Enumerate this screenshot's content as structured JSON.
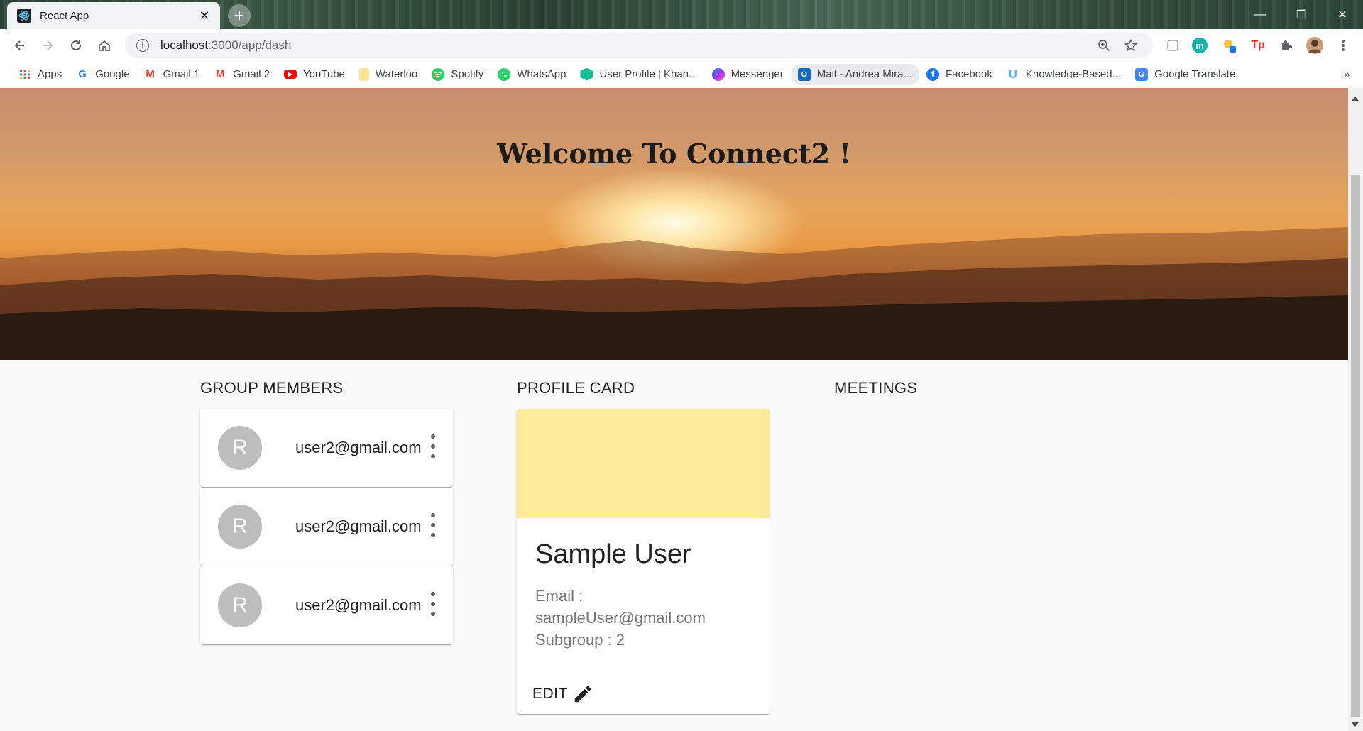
{
  "browser": {
    "tab_title": "React App",
    "tab_close": "✕",
    "new_tab": "+",
    "url_host": "localhost",
    "url_rest": ":3000/app/dash",
    "window_controls": {
      "minimize": "—",
      "restore": "❐",
      "close": "✕"
    },
    "extensions": [
      "m",
      "Tp"
    ],
    "bookmarks_more": "»",
    "bookmarks": [
      {
        "label": "Apps",
        "icon": "apps-grid-icon"
      },
      {
        "label": "Google",
        "icon": "google-icon"
      },
      {
        "label": "Gmail 1",
        "icon": "gmail-icon"
      },
      {
        "label": "Gmail 2",
        "icon": "gmail-icon"
      },
      {
        "label": "YouTube",
        "icon": "youtube-icon"
      },
      {
        "label": "Waterloo",
        "icon": "folder-icon"
      },
      {
        "label": "Spotify",
        "icon": "spotify-icon"
      },
      {
        "label": "WhatsApp",
        "icon": "whatsapp-icon"
      },
      {
        "label": "User Profile | Khan...",
        "icon": "khan-icon"
      },
      {
        "label": "Messenger",
        "icon": "messenger-icon"
      },
      {
        "label": "Mail - Andrea Mira...",
        "icon": "outlook-icon"
      },
      {
        "label": "Facebook",
        "icon": "facebook-icon"
      },
      {
        "label": "Knowledge-Based...",
        "icon": "knowledge-icon"
      },
      {
        "label": "Google Translate",
        "icon": "translate-icon"
      }
    ]
  },
  "hero": {
    "title": "Welcome To Connect2 !"
  },
  "sections": {
    "members_title": "GROUP MEMBERS",
    "profile_title": "PROFILE CARD",
    "meetings_title": "MEETINGS"
  },
  "members": [
    {
      "initial": "R",
      "email": "user2@gmail.com"
    },
    {
      "initial": "R",
      "email": "user2@gmail.com"
    },
    {
      "initial": "R",
      "email": "user2@gmail.com"
    }
  ],
  "profile": {
    "name": "Sample User",
    "email_label": "Email :",
    "email": "sampleUser@gmail.com",
    "subgroup": "Subgroup : 2",
    "edit_label": "EDIT",
    "media_color": "#ffe99a"
  }
}
